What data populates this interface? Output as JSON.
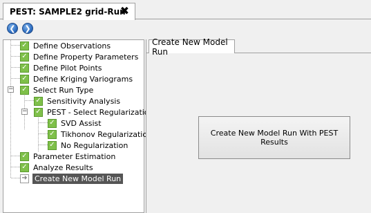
{
  "document_tab": {
    "title": "PEST: SAMPLE2 grid-Run",
    "close_glyph": "✖"
  },
  "toolbar": {
    "back_glyph": "❮",
    "forward_glyph": "❯"
  },
  "tree": {
    "items": [
      {
        "label": "Define Observations"
      },
      {
        "label": "Define Property Parameters"
      },
      {
        "label": "Define Pilot Points"
      },
      {
        "label": "Define Kriging Variograms"
      },
      {
        "label": "Select Run Type"
      },
      {
        "label": "Sensitivity Analysis"
      },
      {
        "label": "PEST - Select Regularization"
      },
      {
        "label": "SVD Assist"
      },
      {
        "label": "Tikhonov Regularization"
      },
      {
        "label": "No Regularization"
      },
      {
        "label": "Parameter Estimation"
      },
      {
        "label": "Analyze Results"
      },
      {
        "label": "Create New Model Run"
      }
    ],
    "check_glyph": "✓",
    "arrow_glyph": "➜",
    "collapse_glyph": "−"
  },
  "content": {
    "tab_label": "Create New Model Run",
    "button_label": "Create New Model Run With PEST Results"
  }
}
